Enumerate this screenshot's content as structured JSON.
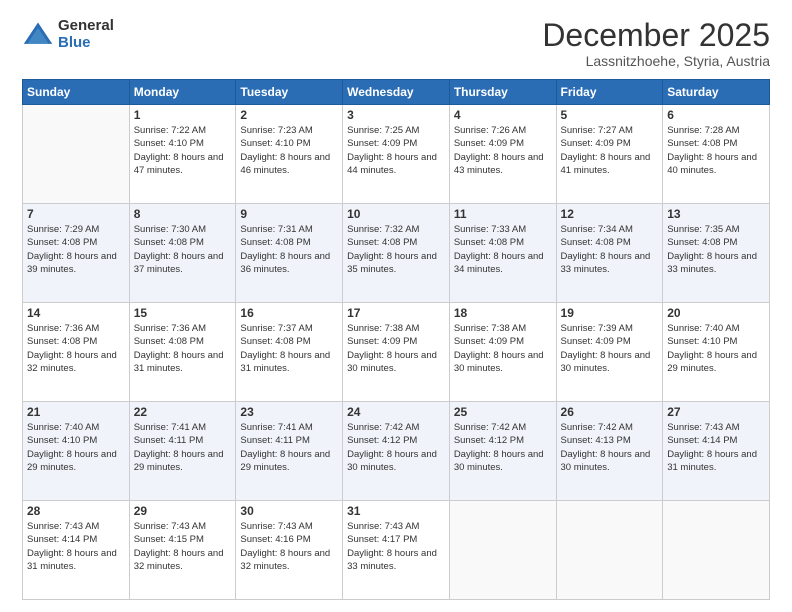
{
  "header": {
    "logo_general": "General",
    "logo_blue": "Blue",
    "month_title": "December 2025",
    "location": "Lassnitzhoehe, Styria, Austria"
  },
  "weekdays": [
    "Sunday",
    "Monday",
    "Tuesday",
    "Wednesday",
    "Thursday",
    "Friday",
    "Saturday"
  ],
  "weeks": [
    [
      {
        "day": "",
        "sunrise": "",
        "sunset": "",
        "daylight": ""
      },
      {
        "day": "1",
        "sunrise": "Sunrise: 7:22 AM",
        "sunset": "Sunset: 4:10 PM",
        "daylight": "Daylight: 8 hours and 47 minutes."
      },
      {
        "day": "2",
        "sunrise": "Sunrise: 7:23 AM",
        "sunset": "Sunset: 4:10 PM",
        "daylight": "Daylight: 8 hours and 46 minutes."
      },
      {
        "day": "3",
        "sunrise": "Sunrise: 7:25 AM",
        "sunset": "Sunset: 4:09 PM",
        "daylight": "Daylight: 8 hours and 44 minutes."
      },
      {
        "day": "4",
        "sunrise": "Sunrise: 7:26 AM",
        "sunset": "Sunset: 4:09 PM",
        "daylight": "Daylight: 8 hours and 43 minutes."
      },
      {
        "day": "5",
        "sunrise": "Sunrise: 7:27 AM",
        "sunset": "Sunset: 4:09 PM",
        "daylight": "Daylight: 8 hours and 41 minutes."
      },
      {
        "day": "6",
        "sunrise": "Sunrise: 7:28 AM",
        "sunset": "Sunset: 4:08 PM",
        "daylight": "Daylight: 8 hours and 40 minutes."
      }
    ],
    [
      {
        "day": "7",
        "sunrise": "Sunrise: 7:29 AM",
        "sunset": "Sunset: 4:08 PM",
        "daylight": "Daylight: 8 hours and 39 minutes."
      },
      {
        "day": "8",
        "sunrise": "Sunrise: 7:30 AM",
        "sunset": "Sunset: 4:08 PM",
        "daylight": "Daylight: 8 hours and 37 minutes."
      },
      {
        "day": "9",
        "sunrise": "Sunrise: 7:31 AM",
        "sunset": "Sunset: 4:08 PM",
        "daylight": "Daylight: 8 hours and 36 minutes."
      },
      {
        "day": "10",
        "sunrise": "Sunrise: 7:32 AM",
        "sunset": "Sunset: 4:08 PM",
        "daylight": "Daylight: 8 hours and 35 minutes."
      },
      {
        "day": "11",
        "sunrise": "Sunrise: 7:33 AM",
        "sunset": "Sunset: 4:08 PM",
        "daylight": "Daylight: 8 hours and 34 minutes."
      },
      {
        "day": "12",
        "sunrise": "Sunrise: 7:34 AM",
        "sunset": "Sunset: 4:08 PM",
        "daylight": "Daylight: 8 hours and 33 minutes."
      },
      {
        "day": "13",
        "sunrise": "Sunrise: 7:35 AM",
        "sunset": "Sunset: 4:08 PM",
        "daylight": "Daylight: 8 hours and 33 minutes."
      }
    ],
    [
      {
        "day": "14",
        "sunrise": "Sunrise: 7:36 AM",
        "sunset": "Sunset: 4:08 PM",
        "daylight": "Daylight: 8 hours and 32 minutes."
      },
      {
        "day": "15",
        "sunrise": "Sunrise: 7:36 AM",
        "sunset": "Sunset: 4:08 PM",
        "daylight": "Daylight: 8 hours and 31 minutes."
      },
      {
        "day": "16",
        "sunrise": "Sunrise: 7:37 AM",
        "sunset": "Sunset: 4:08 PM",
        "daylight": "Daylight: 8 hours and 31 minutes."
      },
      {
        "day": "17",
        "sunrise": "Sunrise: 7:38 AM",
        "sunset": "Sunset: 4:09 PM",
        "daylight": "Daylight: 8 hours and 30 minutes."
      },
      {
        "day": "18",
        "sunrise": "Sunrise: 7:38 AM",
        "sunset": "Sunset: 4:09 PM",
        "daylight": "Daylight: 8 hours and 30 minutes."
      },
      {
        "day": "19",
        "sunrise": "Sunrise: 7:39 AM",
        "sunset": "Sunset: 4:09 PM",
        "daylight": "Daylight: 8 hours and 30 minutes."
      },
      {
        "day": "20",
        "sunrise": "Sunrise: 7:40 AM",
        "sunset": "Sunset: 4:10 PM",
        "daylight": "Daylight: 8 hours and 29 minutes."
      }
    ],
    [
      {
        "day": "21",
        "sunrise": "Sunrise: 7:40 AM",
        "sunset": "Sunset: 4:10 PM",
        "daylight": "Daylight: 8 hours and 29 minutes."
      },
      {
        "day": "22",
        "sunrise": "Sunrise: 7:41 AM",
        "sunset": "Sunset: 4:11 PM",
        "daylight": "Daylight: 8 hours and 29 minutes."
      },
      {
        "day": "23",
        "sunrise": "Sunrise: 7:41 AM",
        "sunset": "Sunset: 4:11 PM",
        "daylight": "Daylight: 8 hours and 29 minutes."
      },
      {
        "day": "24",
        "sunrise": "Sunrise: 7:42 AM",
        "sunset": "Sunset: 4:12 PM",
        "daylight": "Daylight: 8 hours and 30 minutes."
      },
      {
        "day": "25",
        "sunrise": "Sunrise: 7:42 AM",
        "sunset": "Sunset: 4:12 PM",
        "daylight": "Daylight: 8 hours and 30 minutes."
      },
      {
        "day": "26",
        "sunrise": "Sunrise: 7:42 AM",
        "sunset": "Sunset: 4:13 PM",
        "daylight": "Daylight: 8 hours and 30 minutes."
      },
      {
        "day": "27",
        "sunrise": "Sunrise: 7:43 AM",
        "sunset": "Sunset: 4:14 PM",
        "daylight": "Daylight: 8 hours and 31 minutes."
      }
    ],
    [
      {
        "day": "28",
        "sunrise": "Sunrise: 7:43 AM",
        "sunset": "Sunset: 4:14 PM",
        "daylight": "Daylight: 8 hours and 31 minutes."
      },
      {
        "day": "29",
        "sunrise": "Sunrise: 7:43 AM",
        "sunset": "Sunset: 4:15 PM",
        "daylight": "Daylight: 8 hours and 32 minutes."
      },
      {
        "day": "30",
        "sunrise": "Sunrise: 7:43 AM",
        "sunset": "Sunset: 4:16 PM",
        "daylight": "Daylight: 8 hours and 32 minutes."
      },
      {
        "day": "31",
        "sunrise": "Sunrise: 7:43 AM",
        "sunset": "Sunset: 4:17 PM",
        "daylight": "Daylight: 8 hours and 33 minutes."
      },
      {
        "day": "",
        "sunrise": "",
        "sunset": "",
        "daylight": ""
      },
      {
        "day": "",
        "sunrise": "",
        "sunset": "",
        "daylight": ""
      },
      {
        "day": "",
        "sunrise": "",
        "sunset": "",
        "daylight": ""
      }
    ]
  ]
}
